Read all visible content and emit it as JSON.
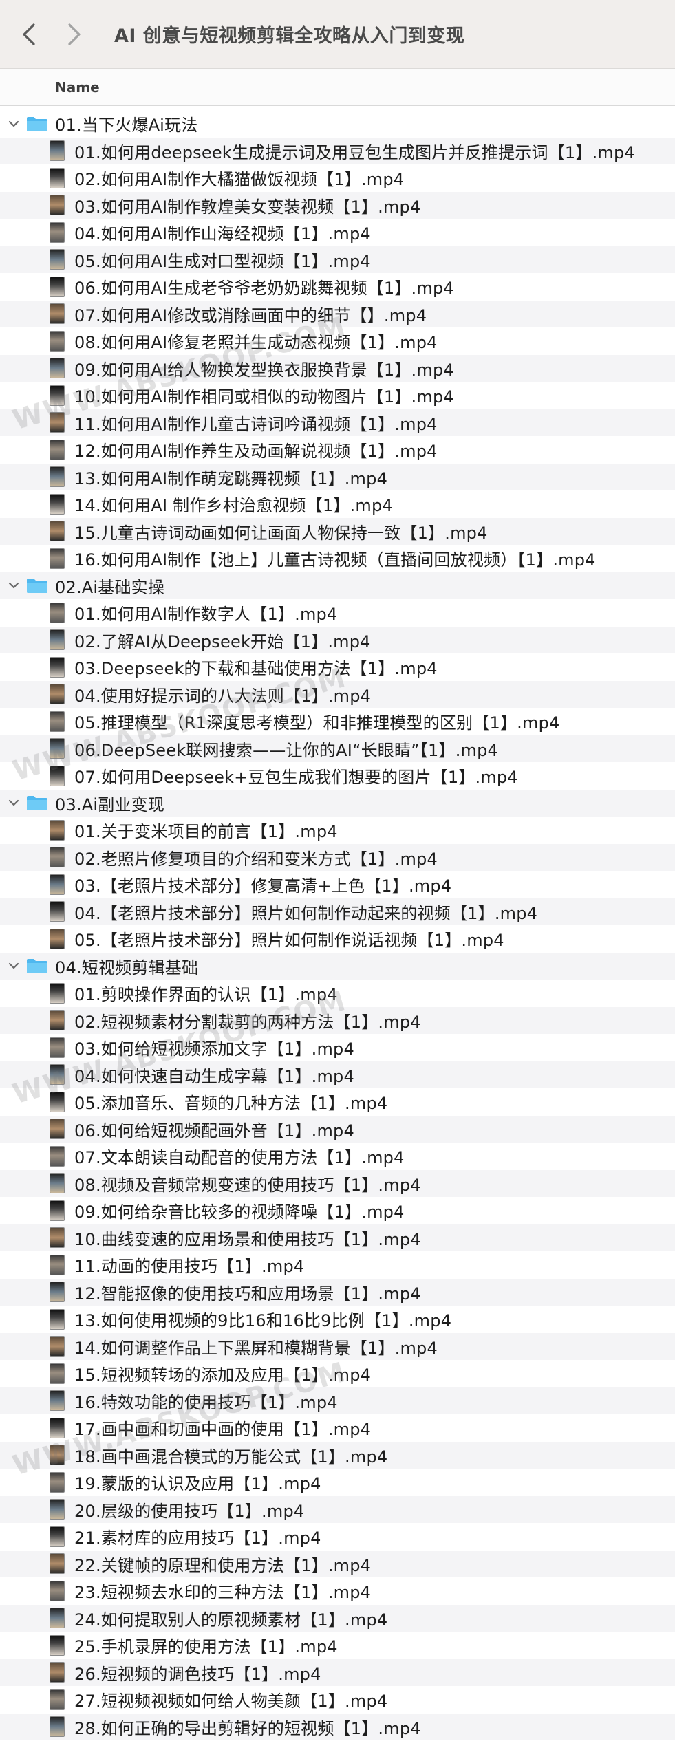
{
  "toolbar": {
    "title": "AI 创意与短视频剪辑全攻略从入门到变现"
  },
  "columns": {
    "name": "Name"
  },
  "watermark": "WWW.ABSKOOP.COM",
  "folders": [
    {
      "name": "01.当下火爆Ai玩法",
      "files": [
        "01.如何用deepseek生成提示词及用豆包生成图片并反推提示词【1】.mp4",
        "02.如何用AI制作大橘猫做饭视频【1】.mp4",
        "03.如何用AI制作敦煌美女变装视频【1】.mp4",
        "04.如何用AI制作山海经视频【1】.mp4",
        "05.如何用AI生成对口型视频【1】.mp4",
        "06.如何用AI生成老爷爷老奶奶跳舞视频【1】.mp4",
        "07.如何用AI修改或消除画面中的细节【】.mp4",
        "08.如何用AI修复老照并生成动态视频【1】.mp4",
        "09.如何用AI给人物换发型换衣服换背景【1】.mp4",
        "10.如何用AI制作相同或相似的动物图片【1】.mp4",
        "11.如何用AI制作儿童古诗词吟诵视频【1】.mp4",
        "12.如何用AI制作养生及动画解说视频【1】.mp4",
        "13.如何用AI制作萌宠跳舞视频【1】.mp4",
        "14.如何用AI 制作乡村治愈视频【1】.mp4",
        "15.儿童古诗词动画如何让画面人物保持一致【1】.mp4",
        "16.如何用AI制作【池上】儿童古诗视频（直播间回放视频）【1】.mp4"
      ]
    },
    {
      "name": "02.Ai基础实操",
      "files": [
        "01.如何用AI制作数字人【1】.mp4",
        "02.了解AI从Deepseek开始【1】.mp4",
        "03.Deepseek的下载和基础使用方法【1】.mp4",
        "04.使用好提示词的八大法则【1】.mp4",
        "05.推理模型（R1深度思考模型）和非推理模型的区别【1】.mp4",
        "06.DeepSeek联网搜索——让你的AI“长眼睛”【1】.mp4",
        "07.如何用Deepseek+豆包生成我们想要的图片【1】.mp4"
      ]
    },
    {
      "name": "03.Ai副业变现",
      "files": [
        "01.关于变米项目的前言【1】.mp4",
        "02.老照片修复项目的介绍和变米方式【1】.mp4",
        "03.【老照片技术部分】修复高清+上色【1】.mp4",
        "04.【老照片技术部分】照片如何制作动起来的视频【1】.mp4",
        "05.【老照片技术部分】照片如何制作说话视频【1】.mp4"
      ]
    },
    {
      "name": "04.短视频剪辑基础",
      "files": [
        "01.剪映操作界面的认识【1】.mp4",
        "02.短视频素材分割裁剪的两种方法【1】.mp4",
        "03.如何给短视频添加文字【1】.mp4",
        "04.如何快速自动生成字幕【1】.mp4",
        "05.添加音乐、音频的几种方法【1】.mp4",
        "06.如何给短视频配画外音【1】.mp4",
        "07.文本朗读自动配音的使用方法【1】.mp4",
        "08.视频及音频常规变速的使用技巧【1】.mp4",
        "09.如何给杂音比较多的视频降噪【1】.mp4",
        "10.曲线变速的应用场景和使用技巧【1】.mp4",
        "11.动画的使用技巧【1】.mp4",
        "12.智能抠像的使用技巧和应用场景【1】.mp4",
        "13.如何使用视频的9比16和16比9比例【1】.mp4",
        "14.如何调整作品上下黑屏和模糊背景【1】.mp4",
        "15.短视频转场的添加及应用【1】.mp4",
        "16.特效功能的使用技巧【1】.mp4",
        "17.画中画和切画中画的使用【1】.mp4",
        "18.画中画混合模式的万能公式【1】.mp4",
        "19.蒙版的认识及应用【1】.mp4",
        "20.层级的使用技巧【1】.mp4",
        "21.素材库的应用技巧【1】.mp4",
        "22.关键帧的原理和使用方法【1】.mp4",
        "23.短视频去水印的三种方法【1】.mp4",
        "24.如何提取别人的原视频素材【1】.mp4",
        "25.手机录屏的使用方法【1】.mp4",
        "26.短视频的调色技巧【1】.mp4",
        "27.短视频视频如何给人物美颜【1】.mp4",
        "28.如何正确的导出剪辑好的短视频【1】.mp4"
      ]
    }
  ]
}
